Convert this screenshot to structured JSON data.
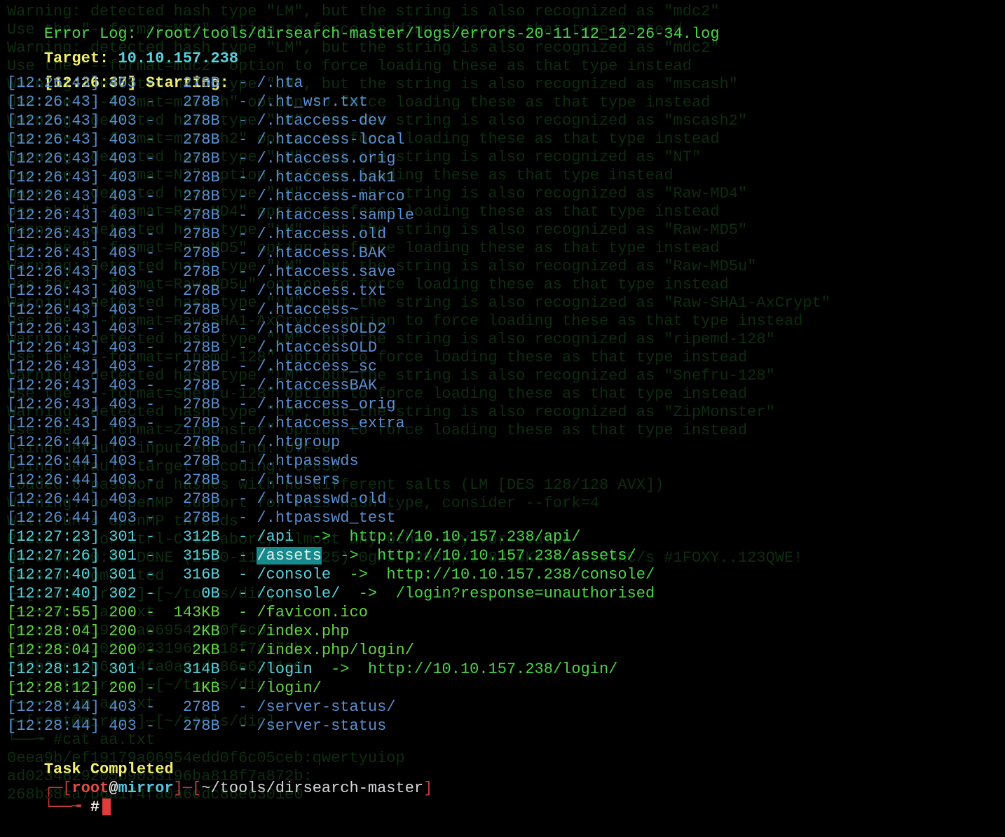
{
  "terminal": {
    "error_log_label": "Error Log:",
    "error_log_path": "/root/tools/dirsearch-master/logs/errors-20-11-12_12-26-34.log",
    "target_label": "Target:",
    "target_value": "10.10.157.238",
    "start_time": "[12:26:37]",
    "start_label": "Starting:",
    "results": [
      {
        "time": "[12:26:43]",
        "code": "403",
        "size": "278B",
        "path": "/.hta",
        "redirect": ""
      },
      {
        "time": "[12:26:43]",
        "code": "403",
        "size": "278B",
        "path": "/.ht_wsr.txt",
        "redirect": ""
      },
      {
        "time": "[12:26:43]",
        "code": "403",
        "size": "278B",
        "path": "/.htaccess-dev",
        "redirect": ""
      },
      {
        "time": "[12:26:43]",
        "code": "403",
        "size": "278B",
        "path": "/.htaccess-local",
        "redirect": ""
      },
      {
        "time": "[12:26:43]",
        "code": "403",
        "size": "278B",
        "path": "/.htaccess.orig",
        "redirect": ""
      },
      {
        "time": "[12:26:43]",
        "code": "403",
        "size": "278B",
        "path": "/.htaccess.bak1",
        "redirect": ""
      },
      {
        "time": "[12:26:43]",
        "code": "403",
        "size": "278B",
        "path": "/.htaccess-marco",
        "redirect": ""
      },
      {
        "time": "[12:26:43]",
        "code": "403",
        "size": "278B",
        "path": "/.htaccess.sample",
        "redirect": ""
      },
      {
        "time": "[12:26:43]",
        "code": "403",
        "size": "278B",
        "path": "/.htaccess.old",
        "redirect": ""
      },
      {
        "time": "[12:26:43]",
        "code": "403",
        "size": "278B",
        "path": "/.htaccess.BAK",
        "redirect": ""
      },
      {
        "time": "[12:26:43]",
        "code": "403",
        "size": "278B",
        "path": "/.htaccess.save",
        "redirect": ""
      },
      {
        "time": "[12:26:43]",
        "code": "403",
        "size": "278B",
        "path": "/.htaccess.txt",
        "redirect": ""
      },
      {
        "time": "[12:26:43]",
        "code": "403",
        "size": "278B",
        "path": "/.htaccess~",
        "redirect": ""
      },
      {
        "time": "[12:26:43]",
        "code": "403",
        "size": "278B",
        "path": "/.htaccessOLD2",
        "redirect": ""
      },
      {
        "time": "[12:26:43]",
        "code": "403",
        "size": "278B",
        "path": "/.htaccessOLD",
        "redirect": ""
      },
      {
        "time": "[12:26:43]",
        "code": "403",
        "size": "278B",
        "path": "/.htaccess_sc",
        "redirect": ""
      },
      {
        "time": "[12:26:43]",
        "code": "403",
        "size": "278B",
        "path": "/.htaccessBAK",
        "redirect": ""
      },
      {
        "time": "[12:26:43]",
        "code": "403",
        "size": "278B",
        "path": "/.htaccess_orig",
        "redirect": ""
      },
      {
        "time": "[12:26:43]",
        "code": "403",
        "size": "278B",
        "path": "/.htaccess_extra",
        "redirect": ""
      },
      {
        "time": "[12:26:44]",
        "code": "403",
        "size": "278B",
        "path": "/.htgroup",
        "redirect": ""
      },
      {
        "time": "[12:26:44]",
        "code": "403",
        "size": "278B",
        "path": "/.htpasswds",
        "redirect": ""
      },
      {
        "time": "[12:26:44]",
        "code": "403",
        "size": "278B",
        "path": "/.htusers",
        "redirect": ""
      },
      {
        "time": "[12:26:44]",
        "code": "403",
        "size": "278B",
        "path": "/.htpasswd-old",
        "redirect": ""
      },
      {
        "time": "[12:26:44]",
        "code": "403",
        "size": "278B",
        "path": "/.htpasswd_test",
        "redirect": ""
      },
      {
        "time": "[12:27:23]",
        "code": "301",
        "size": "312B",
        "path": "/api",
        "redirect": "http://10.10.157.238/api/"
      },
      {
        "time": "[12:27:26]",
        "code": "301",
        "size": "315B",
        "path": "/assets",
        "redirect": "http://10.10.157.238/assets/",
        "highlight": true
      },
      {
        "time": "[12:27:40]",
        "code": "301",
        "size": "316B",
        "path": "/console",
        "redirect": "http://10.10.157.238/console/"
      },
      {
        "time": "[12:27:40]",
        "code": "302",
        "size": "0B",
        "path": "/console/",
        "redirect": "/login?response=unauthorised"
      },
      {
        "time": "[12:27:55]",
        "code": "200",
        "size": "143KB",
        "path": "/favicon.ico",
        "redirect": ""
      },
      {
        "time": "[12:28:04]",
        "code": "200",
        "size": "2KB",
        "path": "/index.php",
        "redirect": ""
      },
      {
        "time": "[12:28:04]",
        "code": "200",
        "size": "2KB",
        "path": "/index.php/login/",
        "redirect": ""
      },
      {
        "time": "[12:28:12]",
        "code": "301",
        "size": "314B",
        "path": "/login",
        "redirect": "http://10.10.157.238/login/"
      },
      {
        "time": "[12:28:12]",
        "code": "200",
        "size": "1KB",
        "path": "/login/",
        "redirect": ""
      },
      {
        "time": "[12:28:44]",
        "code": "403",
        "size": "278B",
        "path": "/server-status/",
        "redirect": ""
      },
      {
        "time": "[12:28:44]",
        "code": "403",
        "size": "278B",
        "path": "/server-status",
        "redirect": ""
      }
    ],
    "task_completed": "Task Completed",
    "prompt": {
      "user": "root",
      "at": "@",
      "host": "mirror",
      "cwd": "~/tools/dirsearch-master",
      "symbol": "#"
    }
  },
  "ghost_text": [
    "Warning: detected hash type \"LM\", but the string is also recognized as \"mdc2\"",
    "Use the \"--format=MD2\" option to force loading these as that type instead",
    "Warning: detected hash type \"LM\", but the string is also recognized as \"mdc2\"",
    "Use the \"--format=mdc2\" option to force loading these as that type instead",
    "Warning: detected hash type \"LM\", but the string is also recognized as \"mscash\"",
    "Use the \"--format=mscash\" option to force loading these as that type instead",
    "Warning: detected hash type \"LM\", but the string is also recognized as \"mscash2\"",
    "Use the \"--format=mscash2\" option to force loading these as that type instead",
    "Warning: detected hash type \"LM\", but the string is also recognized as \"NT\"",
    "Use the \"--format=NT\" option to force loading these as that type instead",
    "Warning: detected hash type \"LM\", but the string is also recognized as \"Raw-MD4\"",
    "Use the \"--format=Raw-MD4\" option to force loading these as that type instead",
    "Warning: detected hash type \"LM\", but the string is also recognized as \"Raw-MD5\"",
    "Use the \"--format=Raw-MD5\" option to force loading these as that type instead",
    "Warning: detected hash type \"LM\", but the string is also recognized as \"Raw-MD5u\"",
    "Use the \"--format=Raw-MD5u\" option to force loading these as that type instead",
    "Warning: detected hash type \"LM\", but the string is also recognized as \"Raw-SHA1-AxCrypt\"",
    "Use the \"--format=Raw-SHA1-AxCrypt\" option to force loading these as that type instead",
    "Warning: detected hash type \"LM\", but the string is also recognized as \"ripemd-128\"",
    "Use the \"--format=ripemd-128\" option to force loading these as that type instead",
    "Warning: detected hash type \"LM\", but the string is also recognized as \"Snefru-128\"",
    "Use the \"--format=Snefru-128\" option to force loading these as that type instead",
    "Warning: detected hash type \"LM\", but the string is also recognized as \"ZipMonster\"",
    "Use the \"--format=ZipMonster\" option to force loading these as that type instead",
    "Using default input encoding: UTF-8",
    "Using default target encoding: CP850",
    "Loaded 6 password hashes with no different salts (LM [DES 128/128 AVX])",
    "Warning: no OpenMP support for this hash type, consider --fork=4",
    "Will run 4 OpenMP threads",
    "Press 'q' or Ctrl-C to abort, almost any other key for status",
    "0g 0:00:00:03 DONE (2020-11-12 12:25) 0g/s 8298Kp/s 8298Kc/s 49789KC/s #1FOXY..123QWE!",
    "Session completed",
    "┌─[root@mirror]─[~/tools/dic]",
    "└──╼ #cat aa.txt",
    "0eea9b/ef19179a06954edd0f6c05ceb",
    "ad0234829205b9033196ba818f7a872b",
    "268b38ca7b6a1f4fa0a6cdc86e6301e0",
    "┌─[root@mirror]─[~/tools/dic]",
    "└──╼ #vim aa.txt",
    "┌─[root@mirror]─[~/tools/dic]",
    "└──╼ #cat aa.txt",
    "0eea9b/ef19179a06954edd0f6c05ceb:qwertyuiop",
    "ad0234829205b9033196ba818f7a872b:",
    "268b38ca7b6a1f4fa0a6cdc86e6301e0",
    ""
  ]
}
